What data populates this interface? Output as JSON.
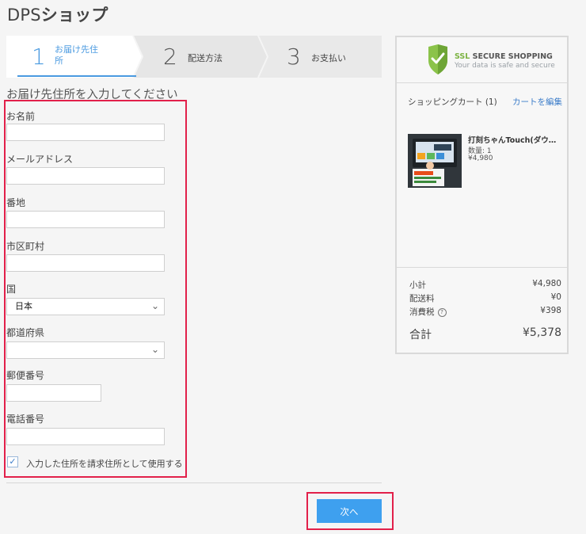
{
  "page": {
    "title_prefix": "DPS",
    "title_suffix": "ショップ"
  },
  "stepper": [
    {
      "num": "1",
      "label": "お届け先住所",
      "active": true
    },
    {
      "num": "2",
      "label": "配送方法",
      "active": false
    },
    {
      "num": "3",
      "label": "お支払い",
      "active": false
    }
  ],
  "form": {
    "section_title": "お届け先住所を入力してください",
    "name_label": "お名前",
    "name_value": "",
    "email_label": "メールアドレス",
    "email_value": "",
    "street_label": "番地",
    "street_value": "",
    "city_label": "市区町村",
    "city_value": "",
    "country_label": "国",
    "country_value": "日本",
    "prefecture_label": "都道府県",
    "prefecture_value": "",
    "postal_label": "郵便番号",
    "postal_value": "",
    "phone_label": "電話番号",
    "phone_value": "",
    "use_as_billing_label": "入力した住所を請求住所として使用する",
    "use_as_billing_checked": true
  },
  "actions": {
    "next_label": "次へ"
  },
  "sidebar": {
    "ssl_word": "SSL",
    "ssl_title_rest": " SECURE SHOPPING",
    "ssl_subtitle": "Your data is safe and secure",
    "cart_title": "ショッピングカート (1)",
    "edit_cart": "カートを編集",
    "product": {
      "name": "打刻ちゃんTouch(ダウンロード版)",
      "qty": "数量: 1",
      "price": "¥4,980"
    },
    "summary": {
      "subtotal_label": "小計",
      "subtotal_value": "¥4,980",
      "shipping_label": "配送料",
      "shipping_value": "¥0",
      "tax_label": "消費税",
      "tax_value": "¥398",
      "total_label": "合計",
      "total_value": "¥5,378"
    }
  },
  "colors": {
    "accent": "#3ea0ef",
    "step_active": "#4a9ae0",
    "highlight_box": "#e2204a",
    "ssl_green": "#7cb342"
  },
  "icons": {
    "dropdown": "chevron-down-icon",
    "checkbox": "checkmark-icon",
    "ssl": "shield-check-icon",
    "help": "question-circle-icon"
  }
}
